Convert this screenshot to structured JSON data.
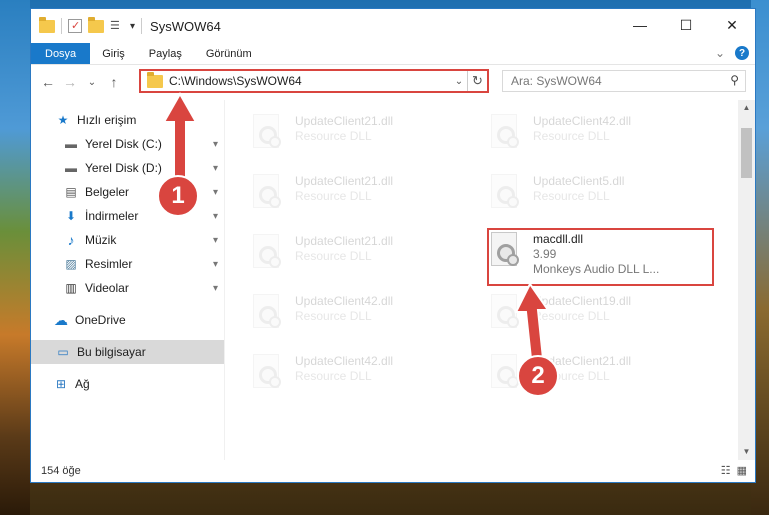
{
  "window": {
    "title": "SysWOW64",
    "min_glyph": "—",
    "max_glyph": "☐",
    "close_glyph": "✕"
  },
  "ribbon": {
    "tabs": [
      "Dosya",
      "Giriş",
      "Paylaş",
      "Görünüm"
    ],
    "collapse_glyph": "⌄",
    "help_glyph": "?"
  },
  "nav": {
    "back_glyph": "←",
    "forward_glyph": "→",
    "recent_glyph": "⌄",
    "up_glyph": "↑"
  },
  "address": {
    "path": "C:\\Windows\\SysWOW64",
    "dropdown_glyph": "⌄",
    "refresh_glyph": "↻"
  },
  "search": {
    "placeholder": "Ara: SysWOW64",
    "icon_glyph": "⚲"
  },
  "sidebar": {
    "items": [
      {
        "label": "Hızlı erişim",
        "icon": "star-icon",
        "glyph": "★",
        "pinned": false
      },
      {
        "label": "Yerel Disk (C:)",
        "icon": "drive-icon",
        "glyph": "▬",
        "pinned": true
      },
      {
        "label": "Yerel Disk (D:)",
        "icon": "drive-icon",
        "glyph": "▬",
        "pinned": true
      },
      {
        "label": "Belgeler",
        "icon": "documents-icon",
        "glyph": "▤",
        "pinned": true
      },
      {
        "label": "İndirmeler",
        "icon": "download-icon",
        "glyph": "⬇",
        "pinned": true
      },
      {
        "label": "Müzik",
        "icon": "music-icon",
        "glyph": "♪",
        "pinned": true
      },
      {
        "label": "Resimler",
        "icon": "pictures-icon",
        "glyph": "▨",
        "pinned": true
      },
      {
        "label": "Videolar",
        "icon": "videos-icon",
        "glyph": "▥",
        "pinned": true
      },
      {
        "label": "OneDrive",
        "icon": "cloud-icon",
        "glyph": "☁",
        "pinned": false
      },
      {
        "label": "Bu bilgisayar",
        "icon": "computer-icon",
        "glyph": "▭",
        "pinned": false
      },
      {
        "label": "Ağ",
        "icon": "network-icon",
        "glyph": "⊞",
        "pinned": false
      }
    ],
    "pin_glyph": "📌"
  },
  "files": [
    {
      "name": "UpdateClient21.dll",
      "line2": "Resource DLL",
      "faded": true
    },
    {
      "name": "UpdateClient42.dll",
      "line2": "Resource DLL",
      "faded": true
    },
    {
      "name": "UpdateClient21.dll",
      "line2": "Resource DLL",
      "faded": true
    },
    {
      "name": "UpdateClient5.dll",
      "line2": "Resource DLL",
      "faded": true
    },
    {
      "name": "UpdateClient21.dll",
      "line2": "Resource DLL",
      "faded": true
    },
    {
      "name": "macdll.dll",
      "line2": "3.99",
      "line3": "Monkeys Audio DLL L...",
      "faded": false
    },
    {
      "name": "UpdateClient42.dll",
      "line2": "Resource DLL",
      "faded": true
    },
    {
      "name": "UpdateClient19.dll",
      "line2": "Resource DLL",
      "faded": true
    },
    {
      "name": "UpdateClient42.dll",
      "line2": "Resource DLL",
      "faded": true
    },
    {
      "name": "UpdateClient21.dll",
      "line2": "Resource DLL",
      "faded": true
    }
  ],
  "scrollbar": {
    "up_glyph": "▲",
    "down_glyph": "▼"
  },
  "status": {
    "count": "154 öğe",
    "details_view_glyph": "☷",
    "tiles_view_glyph": "▦"
  },
  "callouts": [
    "1",
    "2"
  ],
  "colors": {
    "accent": "#1979ca",
    "annotation_red": "#d9453f",
    "selected_nav": "#d9d9d9"
  }
}
